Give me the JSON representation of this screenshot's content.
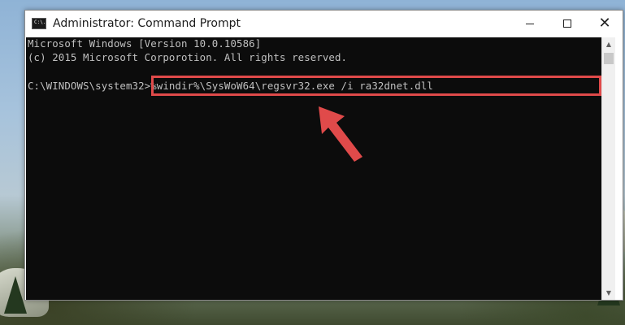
{
  "window": {
    "title": "Administrator: Command Prompt",
    "icon": "cmd-icon",
    "icon_text": "C:\\.",
    "controls": {
      "minimize": "minimize-icon",
      "maximize": "maximize-icon",
      "close": "close-icon",
      "close_glyph": "✕"
    }
  },
  "console": {
    "lines": [
      "Microsoft Windows [Version 10.0.10586]",
      "(c) 2015 Microsoft Corporotion. All rights reserved.",
      "",
      "C:\\WINDOWS\\system32>%windir%\\SysWoW64\\regsvr32.exe /i ra32dnet.dll"
    ],
    "background_color": "#0c0c0c",
    "text_color": "#c0c0c0"
  },
  "annotation": {
    "highlight_color": "#e04a4a",
    "arrow_color": "#e04a4a"
  },
  "scrollbar": {
    "up_glyph": "▲",
    "down_glyph": "▼"
  }
}
